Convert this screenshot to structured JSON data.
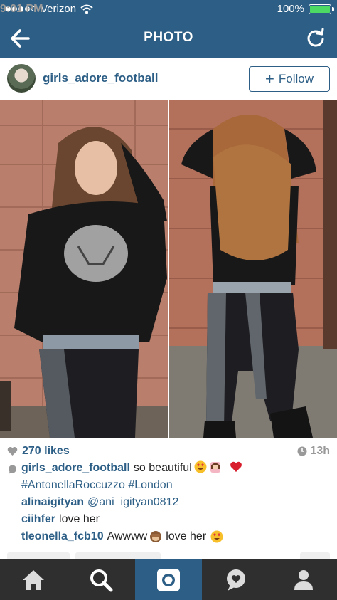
{
  "status_bar": {
    "carrier": "Verizon",
    "time": "9:01 PM",
    "battery": "100%",
    "battery_level": 1.0
  },
  "nav": {
    "title": "PHOTO",
    "back_icon": "arrow-left-icon",
    "refresh_icon": "refresh-icon"
  },
  "post": {
    "username": "girls_adore_football",
    "follow_label": "Follow",
    "likes": "270 likes",
    "age": "13h",
    "caption": {
      "user": "girls_adore_football",
      "text": "so beautiful",
      "hashtags": "#AntonellaRoccuzzo #London"
    },
    "comments": [
      {
        "user": "alinaigityan",
        "text": "@ani_igityan0812"
      },
      {
        "user": "ciihfer",
        "text": "love her"
      },
      {
        "user": "tleonella_fcb10",
        "text": "Awwww",
        "text2": "love her"
      }
    ]
  },
  "tab_bar": {
    "tabs": [
      {
        "name": "home",
        "icon": "home-icon"
      },
      {
        "name": "search",
        "icon": "search-icon"
      },
      {
        "name": "camera",
        "icon": "camera-icon",
        "active": true
      },
      {
        "name": "activity",
        "icon": "activity-icon"
      },
      {
        "name": "profile",
        "icon": "profile-icon"
      }
    ]
  },
  "colors": {
    "brand": "#2d5f86",
    "tab_bar": "#2f2f2f",
    "battery": "#4cd964"
  }
}
